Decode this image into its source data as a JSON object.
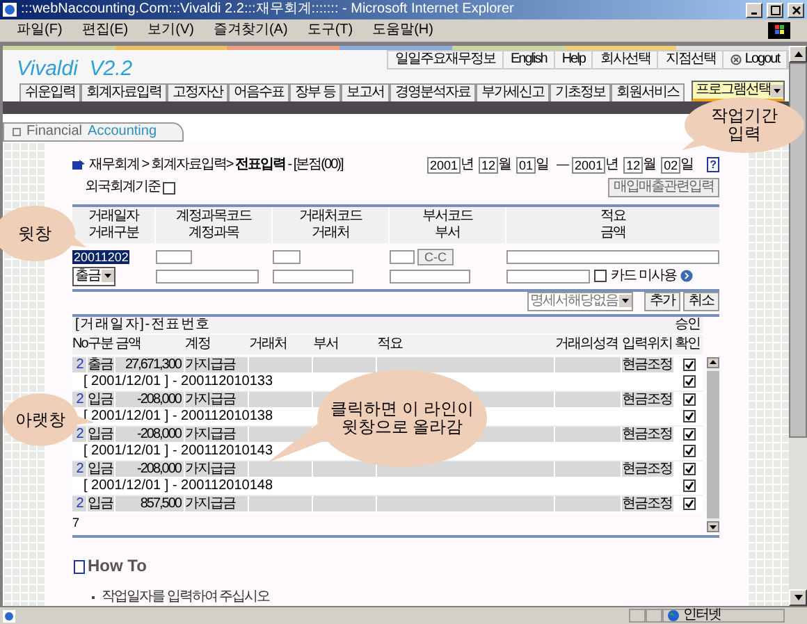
{
  "window": {
    "title": ":::webNaccounting.Com:::Vivaldi 2.2:::재무회계::::::: - Microsoft Internet Explorer"
  },
  "menu": [
    "파일(F)",
    "편집(E)",
    "보기(V)",
    "즐겨찾기(A)",
    "도구(T)",
    "도움말(H)"
  ],
  "top_links": [
    "일일주요재무정보",
    "English",
    "Help",
    "회사선택",
    "지점선택",
    "Logout"
  ],
  "logo": "Vivaldi  V2.2",
  "nav_tabs": [
    "쉬운입력",
    "회계자료입력",
    "고정자산",
    "어음수표",
    "장부 등",
    "보고서",
    "경영분석자료",
    "부가세신고",
    "기초정보",
    "회원서비스"
  ],
  "program_select": "프로그램선택",
  "section_tab": {
    "first": "Financial",
    "second": "Accounting"
  },
  "breadcrumb": {
    "path": "재무회계 > 회계자료입력>",
    "current": "전표입력",
    "branch": "- [본점(00)]"
  },
  "period": {
    "from": [
      {
        "value": "2001",
        "unit": "년"
      },
      {
        "value": "12",
        "unit": "월"
      },
      {
        "value": "01",
        "unit": "일"
      }
    ],
    "separator": "—",
    "to": [
      {
        "value": "2001",
        "unit": "년"
      },
      {
        "value": "12",
        "unit": "월"
      },
      {
        "value": "02",
        "unit": "일"
      }
    ],
    "help": "?"
  },
  "foreign_standard": {
    "label": "외국회계기준",
    "checked": false
  },
  "purchase_button": "매입매출관련입력",
  "form": {
    "headers": [
      [
        "거래일자",
        "거래구분"
      ],
      [
        "계정과목코드",
        "계정과목"
      ],
      [
        "거래처코드",
        "거래처"
      ],
      [
        "부서코드",
        "부서"
      ],
      [
        "적요",
        "금액"
      ]
    ],
    "date_value": "20011202",
    "type_select": "출금",
    "cc_button": "C-C",
    "card": {
      "label": "카드 미사용",
      "checked": false
    }
  },
  "detail_select": "명세서해당없음",
  "add_button": "추가",
  "cancel_button": "취소",
  "list": {
    "title": "[ 거 래 일 자 ] - 전 표 번 호",
    "approval": "승인",
    "columns": [
      "No",
      "구분",
      "금액",
      "계정",
      "거래처",
      "부서",
      "적요",
      "거래의성격",
      "입력위치",
      "확인"
    ],
    "rows": [
      {
        "kind": "entry",
        "no": "2",
        "type": "출금",
        "amount": "27,671,300",
        "account": "가지급금",
        "location": "현금조정",
        "checked": true
      },
      {
        "kind": "voucher",
        "label": "[ 2001/12/01 ] - 200112010133",
        "checked": true
      },
      {
        "kind": "entry",
        "no": "2",
        "type": "입금",
        "amount": "-208,000",
        "account": "가지급금",
        "location": "현금조정",
        "checked": true
      },
      {
        "kind": "voucher",
        "label": "[ 2001/12/01 ] - 200112010138",
        "checked": true
      },
      {
        "kind": "entry",
        "no": "2",
        "type": "입금",
        "amount": "-208,000",
        "account": "가지급금",
        "location": "현금조정",
        "checked": true
      },
      {
        "kind": "voucher",
        "label": "[ 2001/12/01 ] - 200112010143",
        "checked": true
      },
      {
        "kind": "entry",
        "no": "2",
        "type": "입금",
        "amount": "-208,000",
        "account": "가지급금",
        "location": "현금조정",
        "checked": true
      },
      {
        "kind": "voucher",
        "label": "[ 2001/12/01 ] - 200112010148",
        "checked": true
      },
      {
        "kind": "entry",
        "no": "2",
        "type": "입금",
        "amount": "857,500",
        "account": "가지급금",
        "location": "현금조정",
        "checked": true
      }
    ],
    "count": "7"
  },
  "how_to": {
    "title": "How To",
    "items": [
      "작업일자를 입력하여 주십시오"
    ]
  },
  "status_bar": {
    "zone": "인터넷"
  },
  "callouts": [
    {
      "lines": [
        "작업기간",
        "입력"
      ]
    },
    {
      "lines": [
        "윗창"
      ]
    },
    {
      "lines": [
        "아랫창"
      ]
    },
    {
      "lines": [
        "클릭하면 이 라인이",
        "윗창으로 올라감"
      ]
    }
  ]
}
